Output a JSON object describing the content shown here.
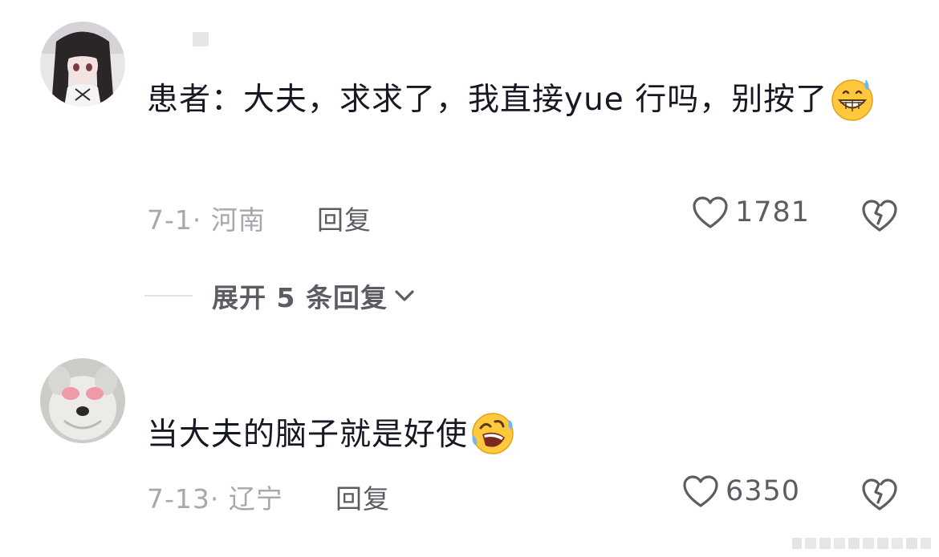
{
  "comments": [
    {
      "text": "患者：大夫，求求了，我直接yue 行吗，别按了",
      "emoji": "grinning-sweat-emoji",
      "date": "7-1",
      "location": "河南",
      "reply_label": "回复",
      "likes": "1781"
    },
    {
      "text": "当大夫的脑子就是好使",
      "emoji": "rolling-laughing-emoji",
      "date": "7-13",
      "location": "辽宁",
      "reply_label": "回复",
      "likes": "6350"
    }
  ],
  "expand": {
    "label": "展开 5 条回复"
  },
  "icons": {
    "like": "heart-outline-icon",
    "dislike": "broken-heart-icon",
    "expand": "chevron-down-icon"
  },
  "colors": {
    "text_primary": "#161823",
    "text_secondary": "#5b5d63",
    "text_meta": "#a6a8ad",
    "emoji_yellow": "#ffc83d"
  }
}
